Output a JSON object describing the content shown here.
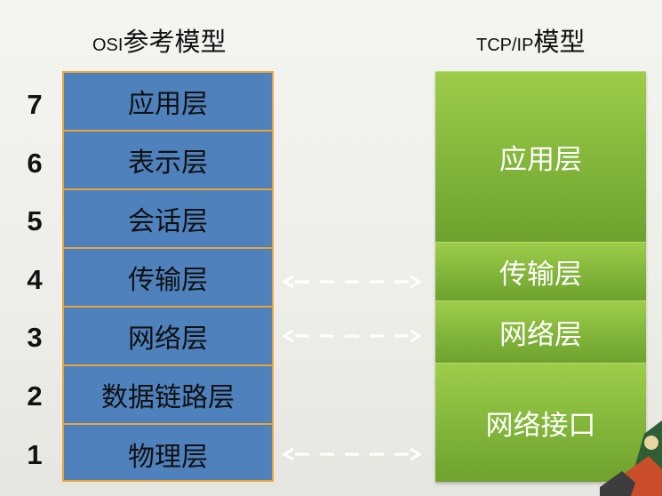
{
  "osi_title_prefix": "OSI",
  "osi_title_rest": "参考模型",
  "tcp_title_prefix": "TCP/IP",
  "tcp_title_rest": "模型",
  "osi_layers": [
    "应用层",
    "表示层",
    "会话层",
    "传输层",
    "网络层",
    "数据链路层",
    "物理层"
  ],
  "layer_numbers": [
    "7",
    "6",
    "5",
    "4",
    "3",
    "2",
    "1"
  ],
  "tcp_layers": [
    "应用层",
    "传输层",
    "网络层",
    "网络接口"
  ],
  "colors": {
    "osi_fill": "#4f81bd",
    "osi_border": "#e8a33c",
    "tcp_fill": "#86b93c",
    "arrow": "#ffffff"
  }
}
